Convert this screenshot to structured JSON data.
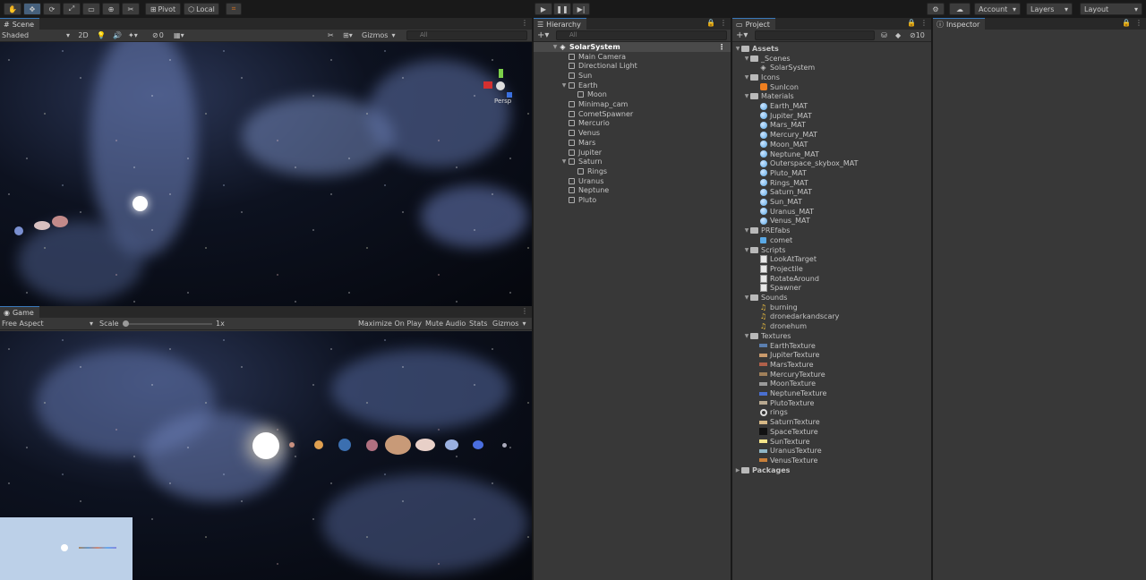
{
  "toolbar": {
    "pivot": "Pivot",
    "local": "Local",
    "account": "Account",
    "layers": "Layers",
    "layout": "Layout"
  },
  "scene": {
    "tab": "Scene",
    "shading": "Shaded",
    "mode2d": "2D",
    "hidden_count": "0",
    "gizmos": "Gizmos",
    "search_placeholder": "All",
    "persp": "Persp"
  },
  "game": {
    "tab": "Game",
    "aspect": "Free Aspect",
    "scale_label": "Scale",
    "scale_value": "1x",
    "maximize": "Maximize On Play",
    "mute": "Mute Audio",
    "stats": "Stats",
    "gizmos": "Gizmos"
  },
  "hierarchy": {
    "tab": "Hierarchy",
    "search_placeholder": "All",
    "root": "SolarSystem",
    "items": [
      {
        "label": "Main Camera",
        "depth": 1
      },
      {
        "label": "Directional Light",
        "depth": 1
      },
      {
        "label": "Sun",
        "depth": 1
      },
      {
        "label": "Earth",
        "depth": 1,
        "expanded": true
      },
      {
        "label": "Moon",
        "depth": 2
      },
      {
        "label": "Minimap_cam",
        "depth": 1
      },
      {
        "label": "CometSpawner",
        "depth": 1
      },
      {
        "label": "Mercurio",
        "depth": 1
      },
      {
        "label": "Venus",
        "depth": 1
      },
      {
        "label": "Mars",
        "depth": 1
      },
      {
        "label": "Jupiter",
        "depth": 1
      },
      {
        "label": "Saturn",
        "depth": 1,
        "expanded": true
      },
      {
        "label": "Rings",
        "depth": 2
      },
      {
        "label": "Uranus",
        "depth": 1
      },
      {
        "label": "Neptune",
        "depth": 1
      },
      {
        "label": "Pluto",
        "depth": 1
      }
    ]
  },
  "project": {
    "tab": "Project",
    "hidden_count": "10",
    "items": [
      {
        "label": "Assets",
        "depth": 0,
        "kind": "folder",
        "bold": true
      },
      {
        "label": "_Scenes",
        "depth": 1,
        "kind": "folder"
      },
      {
        "label": "SolarSystem",
        "depth": 2,
        "kind": "scene"
      },
      {
        "label": "Icons",
        "depth": 1,
        "kind": "folder"
      },
      {
        "label": "SunIcon",
        "depth": 2,
        "kind": "icon",
        "color": "#f08020"
      },
      {
        "label": "Materials",
        "depth": 1,
        "kind": "folder"
      },
      {
        "label": "Earth_MAT",
        "depth": 2,
        "kind": "mat",
        "color": "#5aa9e6"
      },
      {
        "label": "Jupiter_MAT",
        "depth": 2,
        "kind": "mat",
        "color": "#5aa9e6"
      },
      {
        "label": "Mars_MAT",
        "depth": 2,
        "kind": "mat",
        "color": "#5aa9e6"
      },
      {
        "label": "Mercury_MAT",
        "depth": 2,
        "kind": "mat",
        "color": "#5aa9e6"
      },
      {
        "label": "Moon_MAT",
        "depth": 2,
        "kind": "mat",
        "color": "#5aa9e6"
      },
      {
        "label": "Neptune_MAT",
        "depth": 2,
        "kind": "mat",
        "color": "#5aa9e6"
      },
      {
        "label": "Outerspace_skybox_MAT",
        "depth": 2,
        "kind": "mat",
        "color": "#5aa9e6"
      },
      {
        "label": "Pluto_MAT",
        "depth": 2,
        "kind": "mat",
        "color": "#5aa9e6"
      },
      {
        "label": "Rings_MAT",
        "depth": 2,
        "kind": "mat",
        "color": "#5aa9e6"
      },
      {
        "label": "Saturn_MAT",
        "depth": 2,
        "kind": "mat",
        "color": "#5aa9e6"
      },
      {
        "label": "Sun_MAT",
        "depth": 2,
        "kind": "mat",
        "color": "#5aa9e6"
      },
      {
        "label": "Uranus_MAT",
        "depth": 2,
        "kind": "mat",
        "color": "#5aa9e6"
      },
      {
        "label": "Venus_MAT",
        "depth": 2,
        "kind": "mat",
        "color": "#5aa9e6"
      },
      {
        "label": "PREfabs",
        "depth": 1,
        "kind": "folder"
      },
      {
        "label": "comet",
        "depth": 2,
        "kind": "prefab",
        "color": "#5aa9e6"
      },
      {
        "label": "Scripts",
        "depth": 1,
        "kind": "folder"
      },
      {
        "label": "LookAtTarget",
        "depth": 2,
        "kind": "script"
      },
      {
        "label": "Projectile",
        "depth": 2,
        "kind": "script"
      },
      {
        "label": "RotateAround",
        "depth": 2,
        "kind": "script"
      },
      {
        "label": "Spawner",
        "depth": 2,
        "kind": "script"
      },
      {
        "label": "Sounds",
        "depth": 1,
        "kind": "folder"
      },
      {
        "label": "burning",
        "depth": 2,
        "kind": "sound"
      },
      {
        "label": "dronedarkandscary",
        "depth": 2,
        "kind": "sound"
      },
      {
        "label": "dronehum",
        "depth": 2,
        "kind": "sound"
      },
      {
        "label": "Textures",
        "depth": 1,
        "kind": "folder"
      },
      {
        "label": "EarthTexture",
        "depth": 2,
        "kind": "tex",
        "color": "#5b7fb0"
      },
      {
        "label": "JupiterTexture",
        "depth": 2,
        "kind": "tex",
        "color": "#c99a6b"
      },
      {
        "label": "MarsTexture",
        "depth": 2,
        "kind": "tex",
        "color": "#b0604a"
      },
      {
        "label": "MercuryTexture",
        "depth": 2,
        "kind": "tex",
        "color": "#a0805a"
      },
      {
        "label": "MoonTexture",
        "depth": 2,
        "kind": "tex",
        "color": "#9a9a9a"
      },
      {
        "label": "NeptuneTexture",
        "depth": 2,
        "kind": "tex",
        "color": "#4a6fd0"
      },
      {
        "label": "PlutoTexture",
        "depth": 2,
        "kind": "tex",
        "color": "#b8a890"
      },
      {
        "label": "rings",
        "depth": 2,
        "kind": "rings"
      },
      {
        "label": "SaturnTexture",
        "depth": 2,
        "kind": "tex",
        "color": "#d6b886"
      },
      {
        "label": "SpaceTexture",
        "depth": 2,
        "kind": "spacetex"
      },
      {
        "label": "SunTexture",
        "depth": 2,
        "kind": "tex",
        "color": "#f4e48a"
      },
      {
        "label": "UranusTexture",
        "depth": 2,
        "kind": "tex",
        "color": "#8fb6c6"
      },
      {
        "label": "VenusTexture",
        "depth": 2,
        "kind": "tex",
        "color": "#c8803a"
      },
      {
        "label": "Packages",
        "depth": 0,
        "kind": "folder",
        "bold": true
      }
    ]
  },
  "inspector": {
    "tab": "Inspector"
  }
}
